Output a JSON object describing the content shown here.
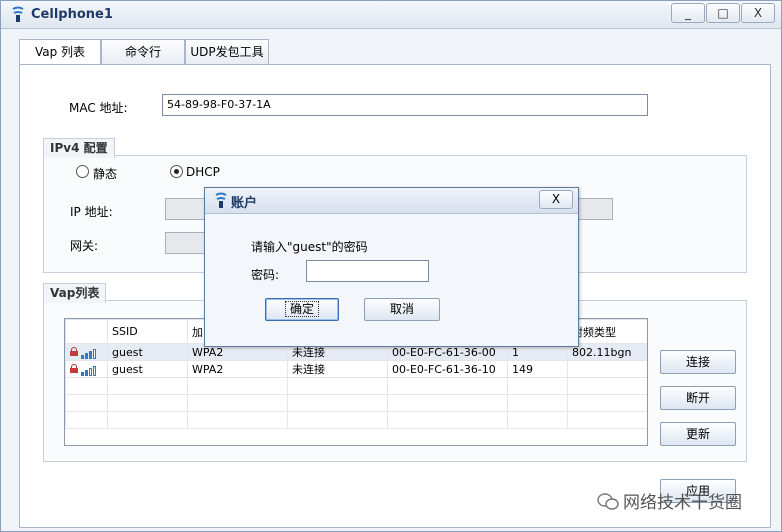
{
  "window": {
    "title": "Cellphone1",
    "min_label": "_",
    "max_label": "□",
    "close_label": "X"
  },
  "tabs": [
    {
      "label": "Vap 列表"
    },
    {
      "label": "命令行"
    },
    {
      "label": "UDP发包工具"
    }
  ],
  "mac": {
    "label": "MAC 地址:",
    "value": "54-89-98-F0-37-1A"
  },
  "ipv4": {
    "title": "IPv4 配置",
    "static_label": "静态",
    "dhcp_label": "DHCP",
    "selected": "DHCP",
    "ip_label": "IP 地址:",
    "gateway_label": "网关:"
  },
  "vap": {
    "title": "Vap列表",
    "columns": [
      "",
      "SSID",
      "加",
      "",
      "",
      "",
      "射频类型"
    ],
    "rows": [
      {
        "ssid": "guest",
        "enc": "WPA2",
        "status": "未连接",
        "bssid": "00-E0-FC-61-36-00",
        "channel": "1",
        "radio": "802.11bgn"
      },
      {
        "ssid": "guest",
        "enc": "WPA2",
        "status": "未连接",
        "bssid": "00-E0-FC-61-36-10",
        "channel": "149",
        "radio": ""
      }
    ],
    "connect_label": "连接",
    "disconnect_label": "断开",
    "refresh_label": "更新",
    "apply_label": "应用"
  },
  "dialog": {
    "title": "账户",
    "close_label": "X",
    "prompt": "请输入\"guest\"的密码",
    "password_label": "密码:",
    "password_value": "",
    "ok_label": "确定",
    "cancel_label": "取消"
  },
  "watermark": {
    "text": "网络技术干货圈"
  },
  "colors": {
    "accent": "#2d79c7",
    "title_text": "#1f3a66",
    "lock": "#c23a3a"
  }
}
